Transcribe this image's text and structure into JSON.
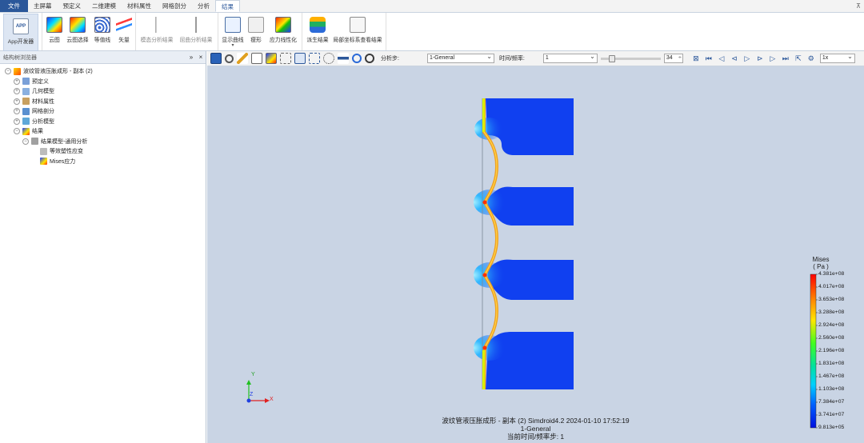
{
  "menu": {
    "tabs": [
      "文件",
      "主屏幕",
      "预定义",
      "二维建模",
      "材料属性",
      "网格剖分",
      "分析",
      "结果"
    ],
    "active_index": 7
  },
  "ribbon": {
    "buttons": [
      "App开发器",
      "云图",
      "云图选择",
      "等值线",
      "矢量",
      "模态分析结果",
      "屈曲分析结果",
      "显示曲线",
      "瘦形",
      "应力线性化",
      "派生结果",
      "局部坐标系查看结果"
    ]
  },
  "left_panel": {
    "title": "结构树浏览器",
    "tree": [
      {
        "label": "波纹管液压胀成形 - 副本 (2)",
        "level": 0,
        "expander": "−",
        "icon": "model-icon"
      },
      {
        "label": "预定义",
        "level": 1,
        "expander": "+",
        "icon": "predefine-icon"
      },
      {
        "label": "几何模型",
        "level": 1,
        "expander": "+",
        "icon": "geometry-icon"
      },
      {
        "label": "材料属性",
        "level": 1,
        "expander": "+",
        "icon": "material-icon"
      },
      {
        "label": "网格剖分",
        "level": 1,
        "expander": "+",
        "icon": "mesh-icon"
      },
      {
        "label": "分析模型",
        "level": 1,
        "expander": "+",
        "icon": "analysis-icon"
      },
      {
        "label": "结果",
        "level": 1,
        "expander": "−",
        "icon": "result-icon"
      },
      {
        "label": "结果模型-通用分析",
        "level": 2,
        "expander": "−",
        "icon": "result-model-icon"
      },
      {
        "label": "等效塑性应变",
        "level": 3,
        "expander": "",
        "icon": "strain-icon"
      },
      {
        "label": "Mises应力",
        "level": 3,
        "expander": "",
        "icon": "stress-icon"
      }
    ]
  },
  "toolbar": {
    "step_label": "分析步:",
    "step_value": "1-General",
    "time_label": "时间/频率:",
    "time_value": "1",
    "frame_value": "34",
    "speed_value": "1x"
  },
  "viewport": {
    "legend": {
      "title": "Mises",
      "unit": "( Pa )",
      "ticks": [
        "4.381e+08",
        "4.017e+08",
        "3.653e+08",
        "3.288e+08",
        "2.924e+08",
        "2.560e+08",
        "2.196e+08",
        "1.831e+08",
        "1.467e+08",
        "1.103e+08",
        "7.384e+07",
        "3.741e+07",
        "9.813e+05"
      ],
      "colors": [
        "#ff0000",
        "#ff3b00",
        "#ff7a00",
        "#ffb400",
        "#ffe800",
        "#c8ff00",
        "#60ff20",
        "#00e640",
        "#00e6a0",
        "#00d8e8",
        "#0096ff",
        "#0050ff",
        "#0010e0"
      ]
    },
    "info_line1": "波纹管液压胀成形 - 副本 (2)  Simdroid4.2  2024-01-10 17:52:19",
    "info_line2": "1-General",
    "info_line3": "当前时间/频率步:  1",
    "triad": {
      "x": "X",
      "y": "Y",
      "z": "Z"
    }
  }
}
